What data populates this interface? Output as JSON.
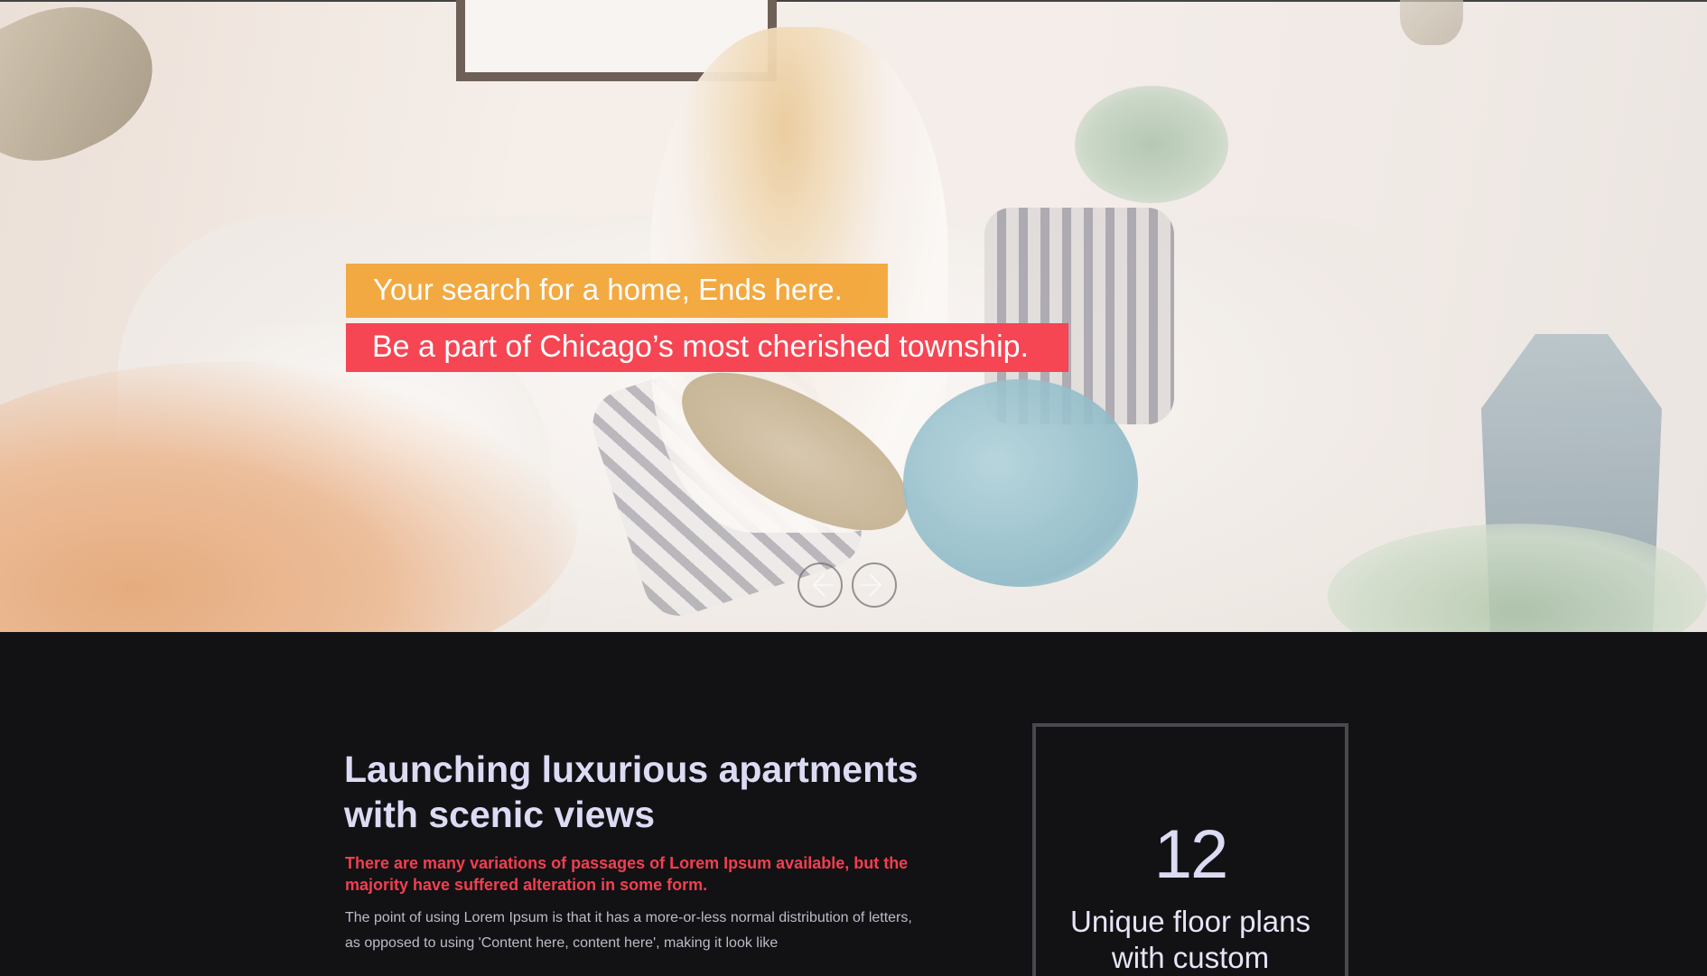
{
  "hero": {
    "tagline": "Your search for a home, Ends here.",
    "subtagline": "Be a part of Chicago’s most cherished township.",
    "tagline_bg": "#f3a433",
    "subtagline_bg": "#f64553",
    "prev_icon": "arrow-left-icon",
    "next_icon": "arrow-right-icon"
  },
  "intro": {
    "headline": "Launching luxurious apartments with scenic views",
    "highlight": "There are many variations of passages of Lorem Ipsum available, but the majority have suffered alteration in some form.",
    "body": "The point of using Lorem Ipsum is that it has a more-or-less normal distribution of letters, as opposed to using 'Content here, content here', making it look like",
    "headline_color": "#dcdbf4",
    "highlight_color": "#f33f4f"
  },
  "stat": {
    "number": "12",
    "label": "Unique floor plans with custom"
  }
}
